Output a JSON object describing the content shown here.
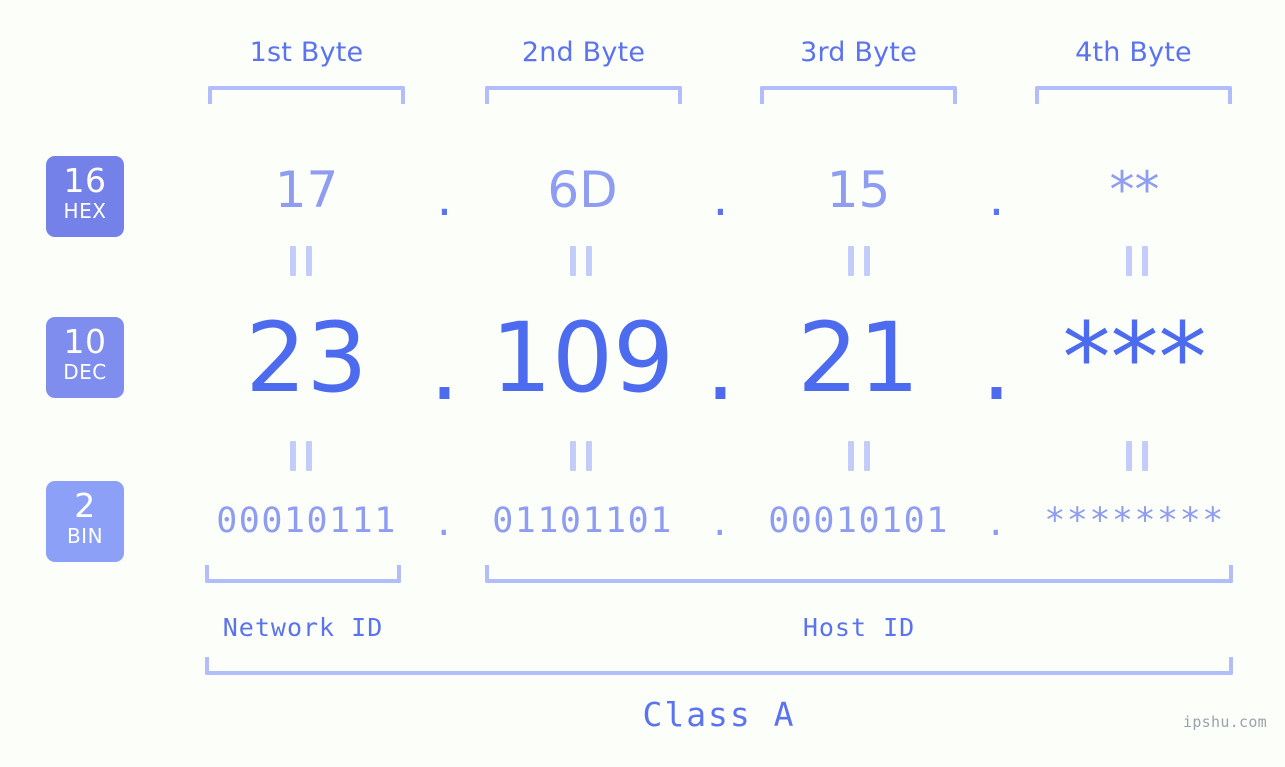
{
  "byte_headers": [
    {
      "label": "1st Byte"
    },
    {
      "label": "2nd Byte"
    },
    {
      "label": "3rd Byte"
    },
    {
      "label": "4th Byte"
    }
  ],
  "badges": [
    {
      "number": "16",
      "abbr": "HEX",
      "color": "#7381e8"
    },
    {
      "number": "10",
      "abbr": "DEC",
      "color": "#7f8def"
    },
    {
      "number": "2",
      "abbr": "BIN",
      "color": "#8ca0f7"
    }
  ],
  "rows": {
    "hex": {
      "values": [
        "17",
        "6D",
        "15",
        "**"
      ],
      "separator": "."
    },
    "dec": {
      "values": [
        "23",
        "109",
        "21",
        "***"
      ],
      "separator": "."
    },
    "bin": {
      "values": [
        "00010111",
        "01101101",
        "00010101",
        "********"
      ],
      "separator": "."
    }
  },
  "equals_symbol": "=",
  "segments": {
    "network_id": "Network ID",
    "host_id": "Host ID"
  },
  "class_label": "Class A",
  "watermark": "ipshu.com",
  "colors": {
    "background": "#fcfefa",
    "bracket": "#b3bdfb",
    "accent_strong": "#4c6bef",
    "accent_mid": "#5b73ee",
    "accent_light": "#8e9cf2",
    "connector": "#c4ccfa",
    "watermark": "#9aa3ad"
  }
}
